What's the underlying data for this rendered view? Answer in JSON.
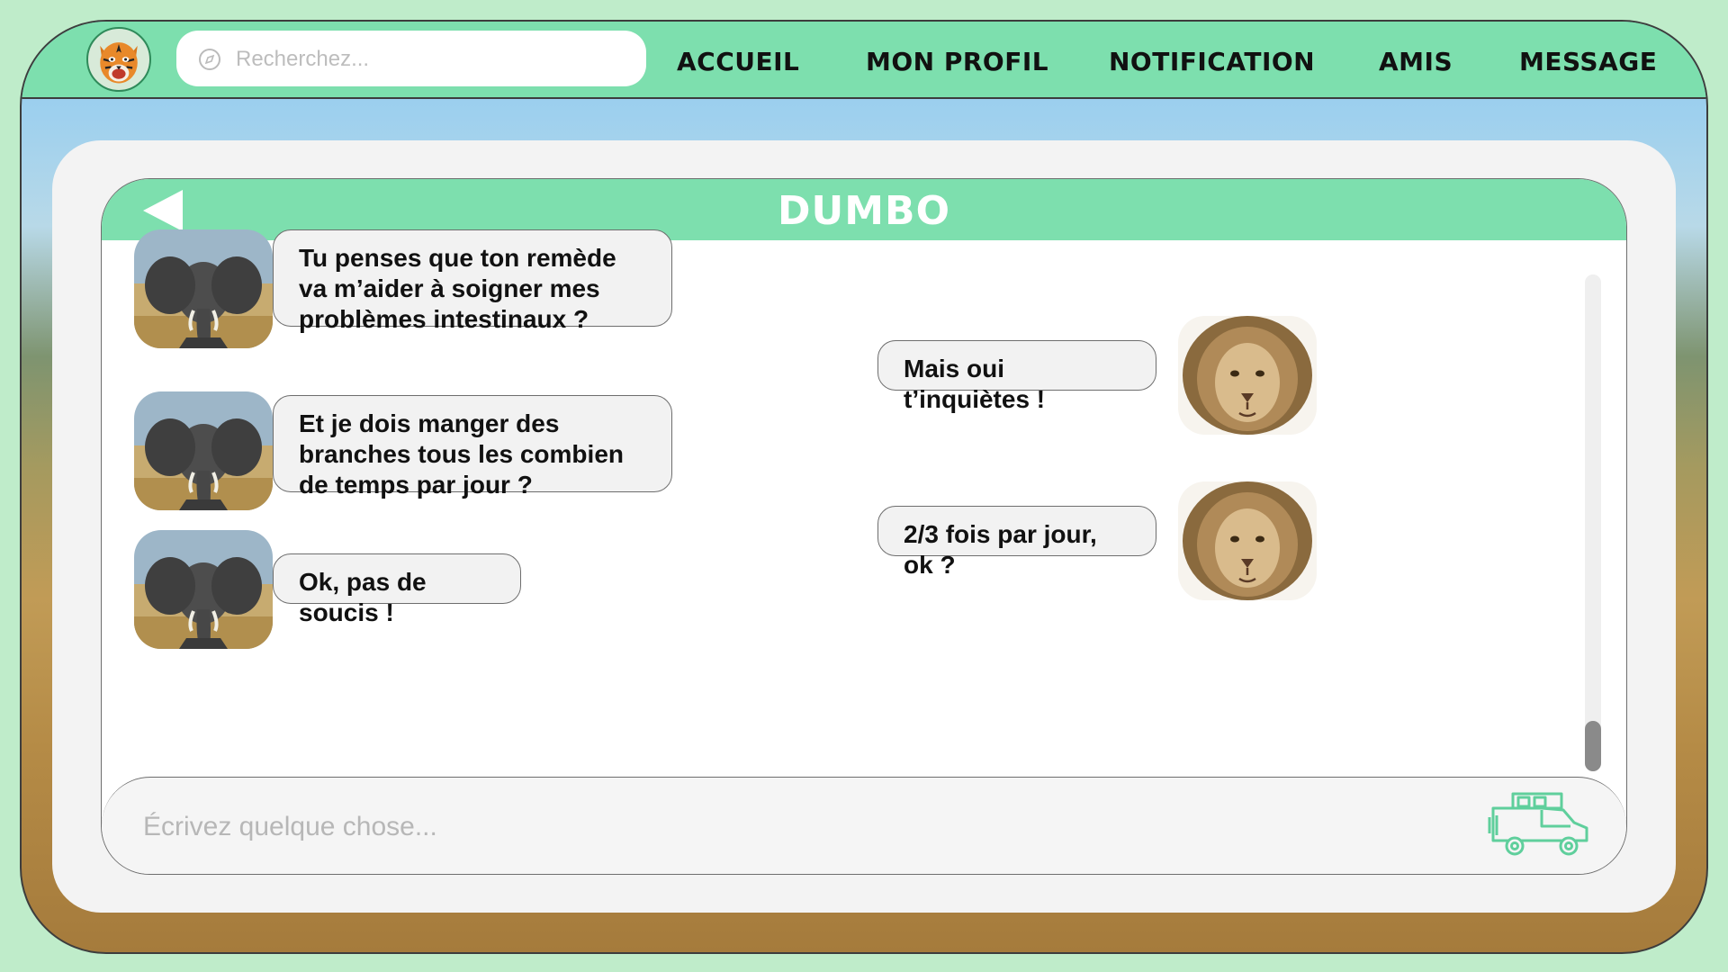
{
  "colors": {
    "accent": "#7ddfae",
    "page_bg": "#bfecca",
    "panel": "#f3f3f3",
    "bubble": "#f2f2f2"
  },
  "header": {
    "logo_icon": "tiger-logo-icon",
    "search": {
      "placeholder": "Recherchez..."
    },
    "nav": [
      "ACCUEIL",
      "MON PROFIL",
      "NOTIFICATION",
      "AMIS",
      "MESSAGE"
    ]
  },
  "chat": {
    "title": "DUMBO",
    "back_icon": "back-arrow-icon",
    "messages": [
      {
        "from": "contact",
        "avatar": "elephant-avatar",
        "text": "Tu penses que ton remède va m’aider à soigner mes problèmes intestinaux ?"
      },
      {
        "from": "me",
        "avatar": "lion-avatar",
        "text": "Mais oui t’inquiètes !"
      },
      {
        "from": "contact",
        "avatar": "elephant-avatar",
        "text": "Et je dois manger des branches tous les combien de temps par jour ?"
      },
      {
        "from": "me",
        "avatar": "lion-avatar",
        "text": "2/3 fois par jour, ok ?"
      },
      {
        "from": "contact",
        "avatar": "elephant-avatar",
        "text": "Ok, pas de soucis !"
      }
    ],
    "composer": {
      "placeholder": "Écrivez quelque chose...",
      "send_icon": "jeep-send-icon"
    }
  }
}
